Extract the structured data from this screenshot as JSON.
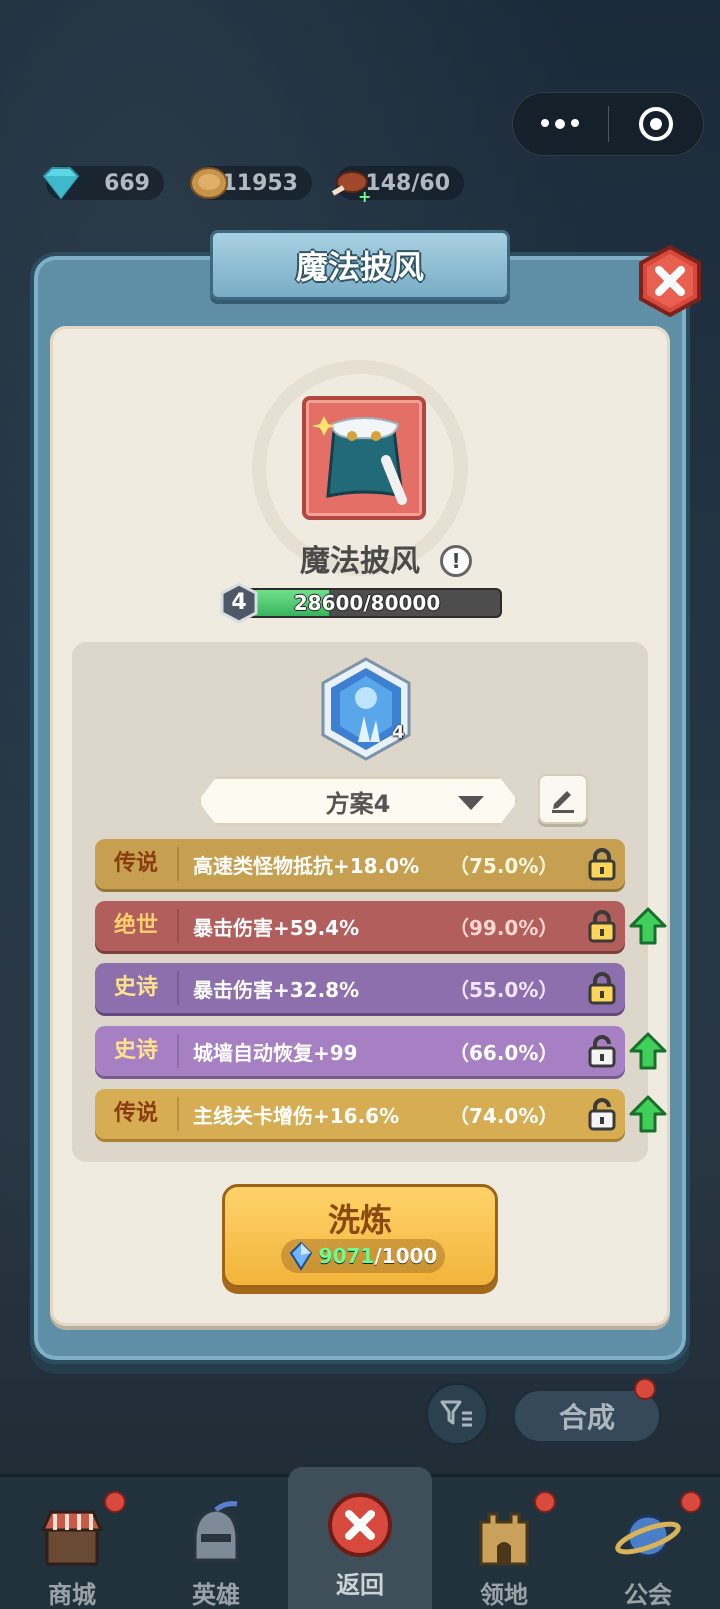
{
  "resources": {
    "gems": "669",
    "coins": "11953",
    "stamina": "148/60"
  },
  "modal": {
    "title": "魔法披风",
    "item_name": "魔法披风",
    "level": "4",
    "exp_text": "28600/80000",
    "exp_fraction": 0.3575,
    "gem_count": "4",
    "plan_label": "方案4",
    "affixes": [
      {
        "tier": "传说",
        "text": "高速类怪物抵抗+18.0%",
        "pct": "（75.0%）",
        "locked": true,
        "upgrade": false
      },
      {
        "tier": "绝世",
        "text": "暴击伤害+59.4%",
        "pct": "（99.0%）",
        "locked": true,
        "upgrade": true
      },
      {
        "tier": "史诗",
        "text": "暴击伤害+32.8%",
        "pct": "（55.0%）",
        "locked": true,
        "upgrade": false
      },
      {
        "tier": "史诗",
        "text": "城墙自动恢复+99",
        "pct": "（66.0%）",
        "locked": false,
        "upgrade": true
      },
      {
        "tier": "传说",
        "text": "主线关卡增伤+16.6%",
        "pct": "（74.0%）",
        "locked": false,
        "upgrade": true
      }
    ],
    "refine": {
      "label": "洗炼",
      "have": "9071",
      "need": "/1000"
    }
  },
  "behind": {
    "merge_label": "合成"
  },
  "bottom_nav": [
    {
      "label": "商城",
      "icon": "shop-icon",
      "badge": true
    },
    {
      "label": "英雄",
      "icon": "helmet-icon",
      "badge": false
    },
    {
      "label": "返回",
      "icon": "close-icon",
      "badge": false,
      "active": true
    },
    {
      "label": "领地",
      "icon": "castle-icon",
      "badge": true
    },
    {
      "label": "公会",
      "icon": "planet-icon",
      "badge": true
    }
  ],
  "colors": {
    "legend": "#c6a050",
    "peerless": "#b25e5c",
    "epic": "#8e6fae",
    "refine_button": "#f2b43b",
    "exp_fill": "#3ab35c"
  }
}
